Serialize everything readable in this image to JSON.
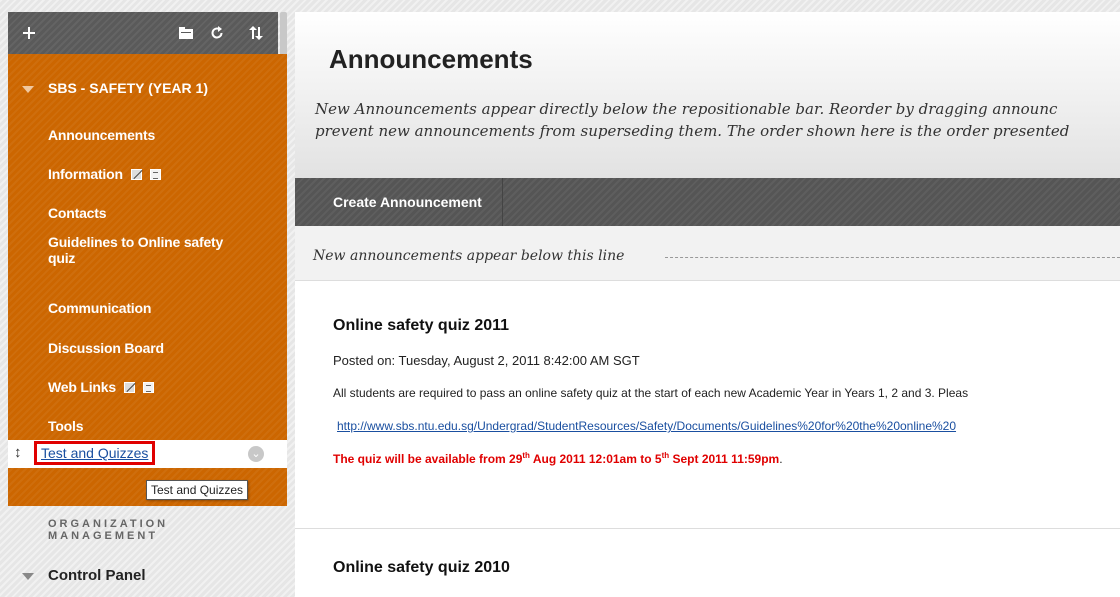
{
  "toolbar": {
    "add_icon": "plus-icon",
    "folder_icon": "folder-icon",
    "refresh_icon": "refresh-icon",
    "sort_icon": "sort-icon"
  },
  "course": {
    "title": "SBS - SAFETY (YEAR 1)",
    "items": [
      {
        "label": "Announcements"
      },
      {
        "label": "Information"
      },
      {
        "label": "Contacts"
      },
      {
        "label": "Guidelines to Online safety quiz"
      },
      {
        "label": "Communication"
      },
      {
        "label": "Discussion Board"
      },
      {
        "label": "Web Links"
      },
      {
        "label": "Tools"
      }
    ],
    "selected_label": "Test and Quizzes",
    "tooltip": "Test and Quizzes"
  },
  "org": {
    "heading": "ORGANIZATION MANAGEMENT",
    "control_panel": "Control Panel"
  },
  "page": {
    "title": "Announcements",
    "description_line1": "New Announcements appear directly below the repositionable bar. Reorder by dragging announc",
    "description_line2": "prevent new announcements from superseding them. The order shown here is the order presented",
    "create_button": "Create Announcement",
    "reposition_text": "New announcements appear below this line"
  },
  "announcements": [
    {
      "title": "Online safety quiz 2011",
      "posted": "Posted on: Tuesday, August 2, 2011 8:42:00 AM SGT",
      "body": "All students are required to pass an online safety quiz at the start of each new Academic Year in Years 1, 2 and 3. Pleas",
      "link": "http://www.sbs.ntu.edu.sg/Undergrad/StudentResources/Safety/Documents/Guidelines%20for%20the%20online%20",
      "alert_part1": "The quiz will be available from 29",
      "alert_sup1": "th",
      "alert_part2": " Aug 2011 12:01am to 5",
      "alert_sup2": "th",
      "alert_part3": " Sept 2011 11:59pm",
      "alert_tail": "."
    },
    {
      "title": "Online safety quiz 2010"
    }
  ],
  "colors": {
    "course_menu": "#cc6600",
    "toolbar": "#5a5a5a",
    "alert": "#e00000",
    "link": "#1a4fa0"
  }
}
